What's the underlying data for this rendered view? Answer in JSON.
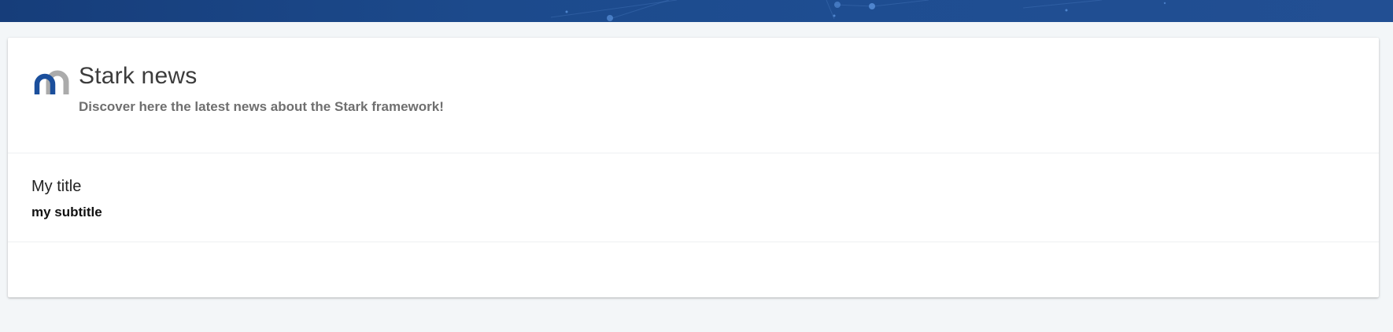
{
  "header": {
    "title": "Stark news",
    "subtitle": "Discover here the latest news about the Stark framework!",
    "logo_icon": "stark-logo-icon"
  },
  "item": {
    "title": "My title",
    "subtitle": "my subtitle"
  },
  "colors": {
    "banner": "#1c4a8c",
    "background": "#f3f6f8",
    "logo_blue": "#1b4f9c",
    "logo_gray": "#9c9c9c",
    "title_text": "#3c3c3c",
    "subtitle_text": "#6f6f6f"
  }
}
